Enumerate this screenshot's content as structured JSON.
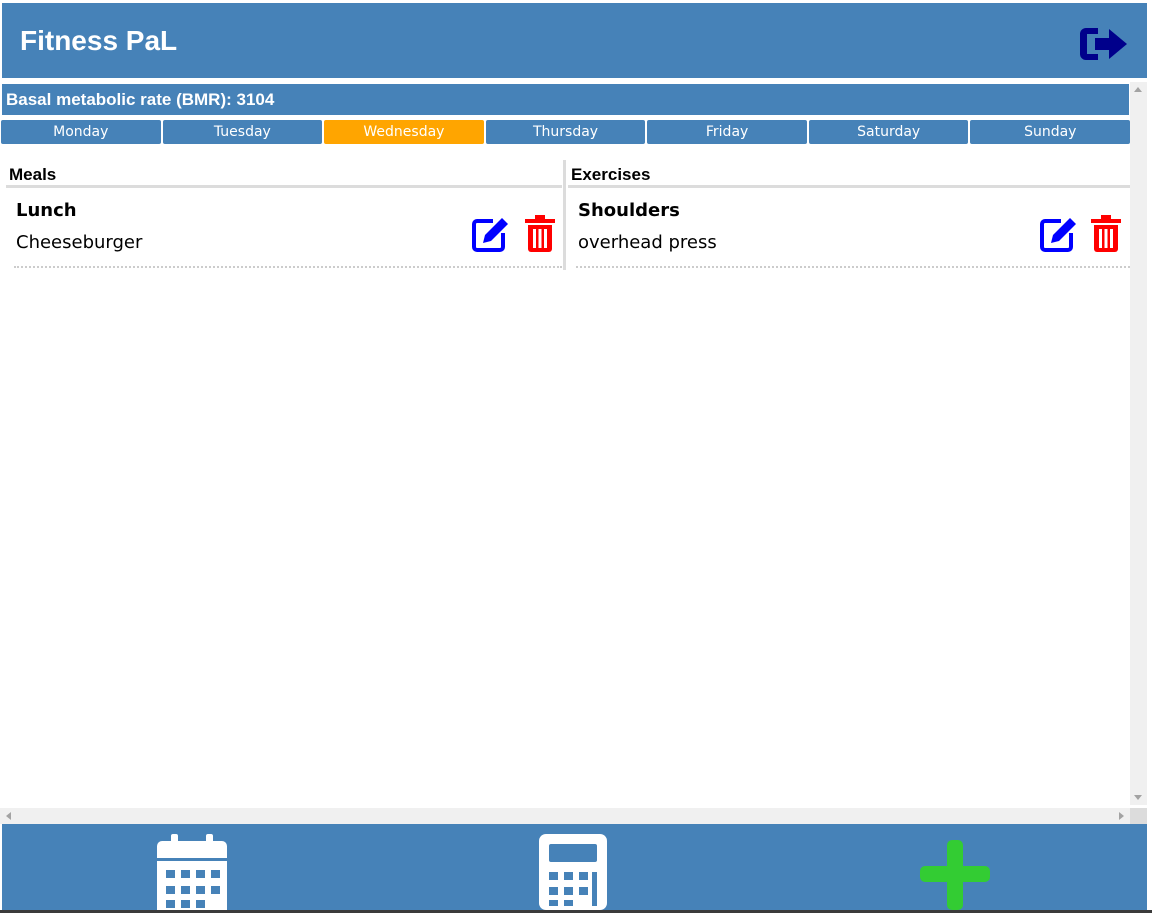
{
  "app": {
    "title": "Fitness PaL"
  },
  "icons": {
    "logout": "sign-out-icon",
    "edit": "edit-icon",
    "delete": "trash-icon",
    "calendar": "calendar-icon",
    "calculator": "calculator-icon",
    "add": "plus-icon"
  },
  "colors": {
    "primary": "#4682b8",
    "active_day": "#ffa500",
    "edit": "#0000ff",
    "delete": "#ff0000",
    "add": "#33cc33",
    "logout": "#00008b"
  },
  "bmr": {
    "text": "Basal metabolic rate (BMR): 3104"
  },
  "days": [
    {
      "label": "Monday",
      "active": false
    },
    {
      "label": "Tuesday",
      "active": false
    },
    {
      "label": "Wednesday",
      "active": true
    },
    {
      "label": "Thursday",
      "active": false
    },
    {
      "label": "Friday",
      "active": false
    },
    {
      "label": "Saturday",
      "active": false
    },
    {
      "label": "Sunday",
      "active": false
    }
  ],
  "meals": {
    "heading": "Meals",
    "items": [
      {
        "title": "Lunch",
        "subtitle": "Cheeseburger"
      }
    ]
  },
  "exercises": {
    "heading": "Exercises",
    "items": [
      {
        "title": "Shoulders",
        "subtitle": "overhead press"
      }
    ]
  }
}
